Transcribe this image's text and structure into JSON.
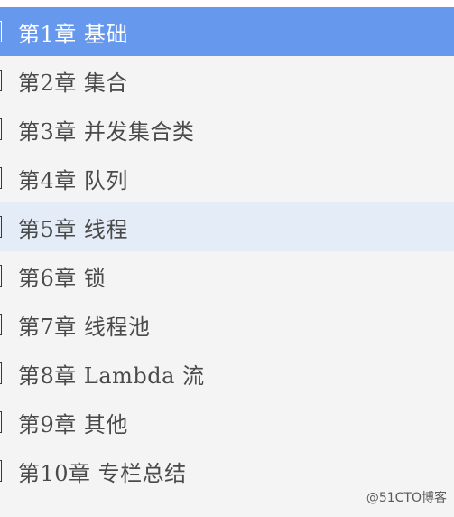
{
  "chapters": [
    {
      "label": "第1章 基础",
      "state": "active"
    },
    {
      "label": "第2章 集合",
      "state": "normal"
    },
    {
      "label": "第3章 并发集合类",
      "state": "normal"
    },
    {
      "label": "第4章 队列",
      "state": "normal"
    },
    {
      "label": "第5章 线程",
      "state": "hover"
    },
    {
      "label": "第6章 锁",
      "state": "normal"
    },
    {
      "label": "第7章 线程池",
      "state": "normal"
    },
    {
      "label": "第8章 Lambda 流",
      "state": "normal"
    },
    {
      "label": "第9章 其他",
      "state": "normal"
    },
    {
      "label": "第10章 专栏总结",
      "state": "normal"
    }
  ],
  "watermark": "@51CTO博客",
  "colors": {
    "active_bg": "#6699ee",
    "hover_bg": "#e4ecf7",
    "list_bg": "#f4f4f4",
    "text": "#4a4a4a"
  }
}
